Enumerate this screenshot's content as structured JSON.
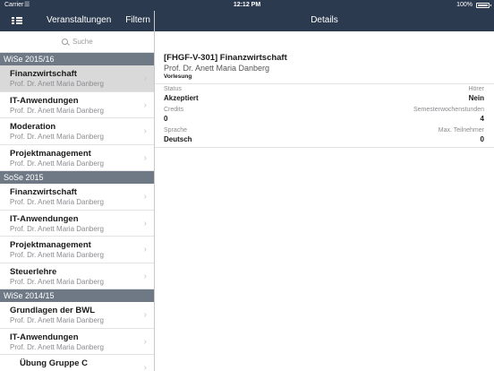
{
  "status": {
    "carrier": "Carrier",
    "time": "12:12 PM",
    "battery": "100%"
  },
  "nav": {
    "left_title": "Veranstaltungen",
    "filter": "Filtern",
    "right_title": "Details"
  },
  "search": {
    "placeholder": "Suche"
  },
  "sections": [
    {
      "title": "WiSe 2015/16",
      "items": [
        {
          "title": "Finanzwirtschaft",
          "subtitle": "Prof. Dr. Anett Maria Danberg",
          "selected": true
        },
        {
          "title": "IT-Anwendungen",
          "subtitle": "Prof. Dr. Anett Maria Danberg"
        },
        {
          "title": "Moderation",
          "subtitle": "Prof. Dr. Anett Maria Danberg"
        },
        {
          "title": "Projektmanagement",
          "subtitle": "Prof. Dr. Anett Maria Danberg"
        }
      ]
    },
    {
      "title": "SoSe 2015",
      "items": [
        {
          "title": "Finanzwirtschaft",
          "subtitle": "Prof. Dr. Anett Maria Danberg"
        },
        {
          "title": "IT-Anwendungen",
          "subtitle": "Prof. Dr. Anett Maria Danberg"
        },
        {
          "title": "Projektmanagement",
          "subtitle": "Prof. Dr. Anett Maria Danberg"
        },
        {
          "title": "Steuerlehre",
          "subtitle": "Prof. Dr. Anett Maria Danberg"
        }
      ]
    },
    {
      "title": "WiSe 2014/15",
      "items": [
        {
          "title": "Grundlagen der BWL",
          "subtitle": "Prof. Dr. Anett Maria Danberg"
        },
        {
          "title": "IT-Anwendungen",
          "subtitle": "Prof. Dr. Anett Maria Danberg"
        },
        {
          "title": "Übung Gruppe C",
          "subtitle": ""
        }
      ]
    }
  ],
  "detail": {
    "title": "[FHGF-V-301] Finanzwirtschaft",
    "professor": "Prof. Dr. Anett Maria Danberg",
    "type": "Vorlesung",
    "rows": [
      {
        "left_label": "Status",
        "left_value": "Akzeptiert",
        "right_label": "Hörer",
        "right_value": "Nein"
      },
      {
        "left_label": "Credits",
        "left_value": "0",
        "right_label": "Semesterwochenstunden",
        "right_value": "4"
      },
      {
        "left_label": "Sprache",
        "left_value": "Deutsch",
        "right_label": "Max. Teilnehmer",
        "right_value": "0"
      }
    ]
  },
  "colors": {
    "navbar": "#2b3a4f",
    "section": "#6f7986",
    "selected": "#d9d9d9"
  }
}
